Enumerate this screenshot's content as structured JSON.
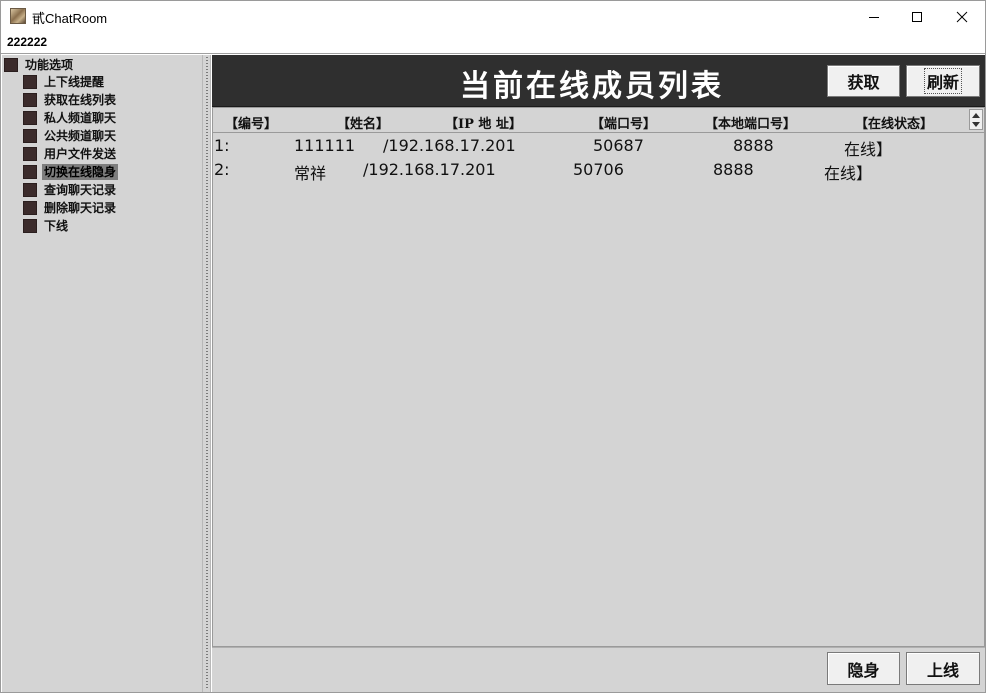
{
  "window": {
    "title": "甙ChatRoom",
    "user": "222222"
  },
  "tree": {
    "root": "功能选项",
    "items": [
      {
        "label": "上下线提醒",
        "selected": false
      },
      {
        "label": "获取在线列表",
        "selected": false
      },
      {
        "label": "私人频道聊天",
        "selected": false
      },
      {
        "label": "公共频道聊天",
        "selected": false
      },
      {
        "label": "用户文件发送",
        "selected": false
      },
      {
        "label": "切换在线隐身",
        "selected": true
      },
      {
        "label": "查询聊天记录",
        "selected": false
      },
      {
        "label": "删除聊天记录",
        "selected": false
      },
      {
        "label": "下线",
        "selected": false
      }
    ]
  },
  "header": {
    "title": "当前在线成员列表",
    "fetch_label": "获取",
    "refresh_label": "刷新"
  },
  "table": {
    "columns": [
      "【编号】",
      "【姓名】",
      "【IP 地 址】",
      "【端口号】",
      "【本地端口号】",
      "【在线状态】"
    ],
    "rows": [
      [
        "1:",
        "111111",
        "/192.168.17.201",
        "50687",
        "8888",
        "在线】"
      ],
      [
        "2:",
        "常祥",
        "/192.168.17.201",
        "50706",
        "8888",
        "在线】"
      ]
    ]
  },
  "footer": {
    "hide_label": "隐身",
    "online_label": "上线"
  },
  "colors": {
    "header_band": "#2f2f2f",
    "panel": "#d4d4d4",
    "tree_box": "#3b2b2b",
    "selected": "#7d7d7d"
  }
}
